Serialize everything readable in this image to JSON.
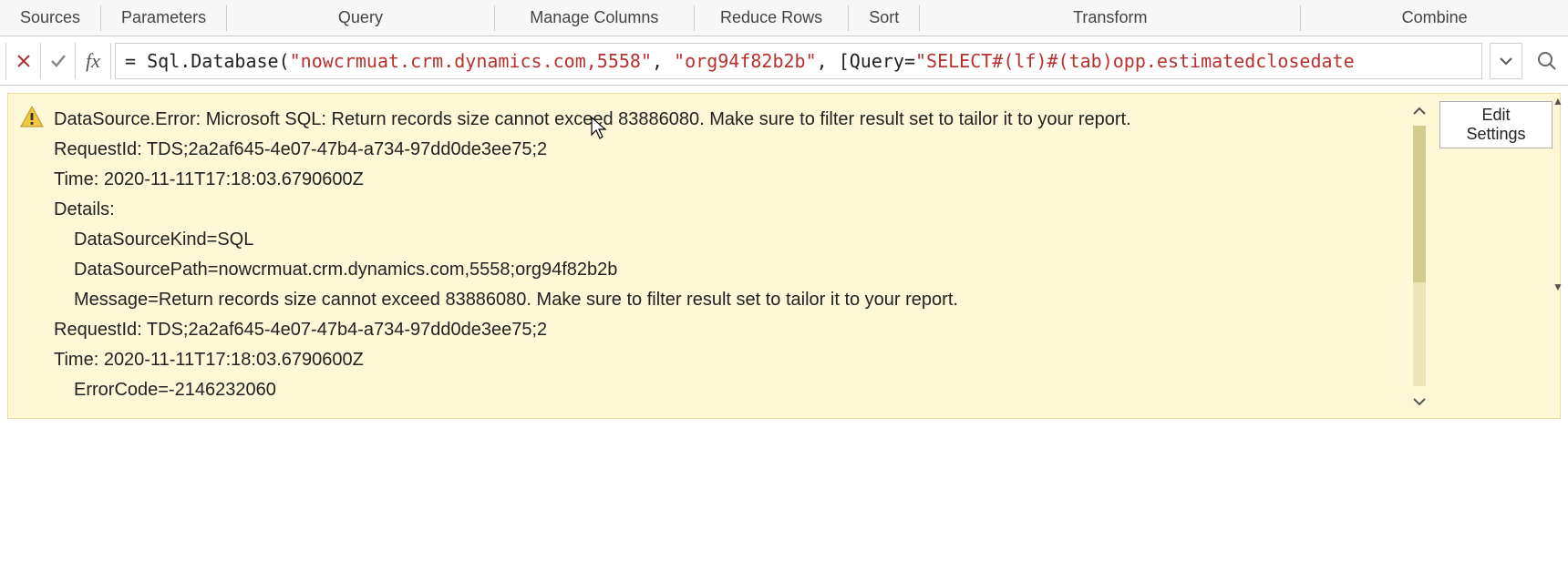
{
  "ribbon": {
    "groups": [
      "Sources",
      "Parameters",
      "Query",
      "Manage Columns",
      "Reduce Rows",
      "Sort",
      "Transform",
      "Combine"
    ]
  },
  "formula_bar": {
    "fx_label": "fx",
    "formula_prefix": "= Sql.Database(",
    "str1": "\"nowcrmuat.crm.dynamics.com,5558\"",
    "sep1": ", ",
    "str2": "\"org94f82b2b\"",
    "sep2": ", [Query=",
    "str3": "\"SELECT#(lf)#(tab)opp.estimatedclosedate"
  },
  "error": {
    "line1": "DataSource.Error: Microsoft SQL: Return records size cannot exceed 83886080. Make sure to filter result set to tailor it to your report.",
    "line2": "RequestId: TDS;2a2af645-4e07-47b4-a734-97dd0de3ee75;2",
    "line3": "Time: 2020-11-11T17:18:03.6790600Z",
    "line4": "Details:",
    "line5": "DataSourceKind=SQL",
    "line6": "DataSourcePath=nowcrmuat.crm.dynamics.com,5558;org94f82b2b",
    "line7": "Message=Return records size cannot exceed 83886080. Make sure to filter result set to tailor it to your report.",
    "line8": "RequestId: TDS;2a2af645-4e07-47b4-a734-97dd0de3ee75;2",
    "line9": "Time: 2020-11-11T17:18:03.6790600Z",
    "line10": "ErrorCode=-2146232060",
    "edit_settings": "Edit Settings"
  }
}
